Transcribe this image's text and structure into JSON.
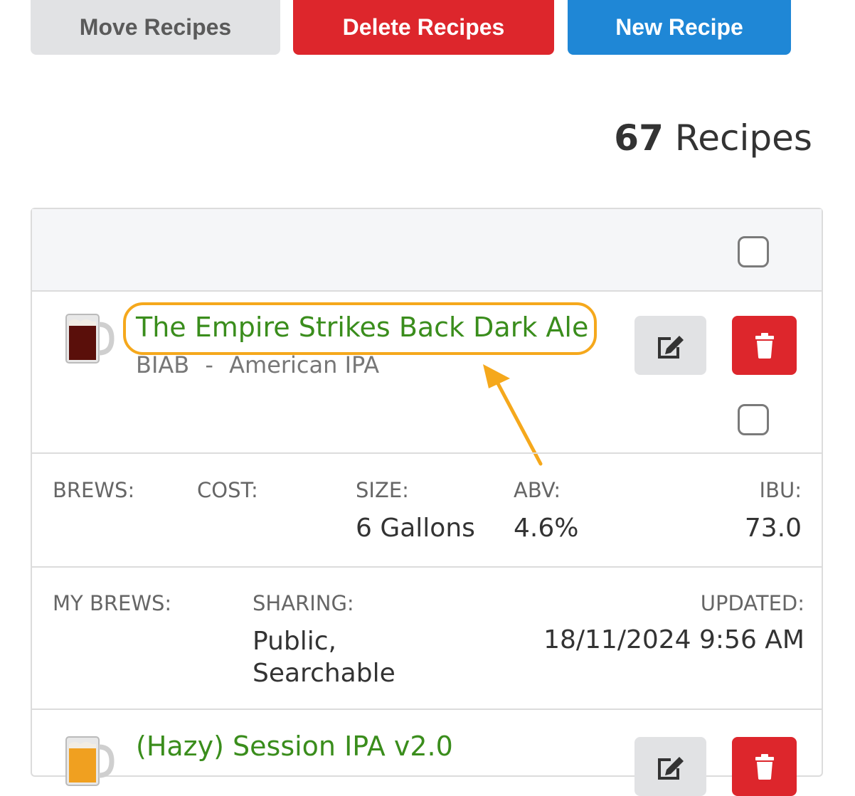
{
  "toolbar": {
    "move_label": "Move Recipes",
    "delete_label": "Delete Recipes",
    "new_label": "New Recipe"
  },
  "summary": {
    "count": "67",
    "count_suffix": "Recipes"
  },
  "recipes": [
    {
      "name": "The Empire Strikes Back Dark Ale",
      "method": "BIAB",
      "separator": "-",
      "style": "American IPA",
      "mug_color": "#5a0f0a",
      "highlighted": true,
      "stats": {
        "brews_label": "BREWS:",
        "cost_label": "COST:",
        "size_label": "SIZE:",
        "size_value": "6 Gallons",
        "abv_label": "ABV:",
        "abv_value": "4.6%",
        "ibu_label": "IBU:",
        "ibu_value": "73.0"
      },
      "meta": {
        "my_brews_label": "MY BREWS:",
        "sharing_label": "SHARING:",
        "sharing_line1": "Public,",
        "sharing_line2": "Searchable",
        "updated_label": "UPDATED:",
        "updated_value": "18/11/2024 9:56 AM"
      }
    },
    {
      "name": "(Hazy) Session IPA v2.0",
      "mug_color": "#f0a020"
    }
  ],
  "colors": {
    "accent_green": "#3a8d1c",
    "danger": "#dd262c",
    "primary": "#1f87d6",
    "highlight": "#f5a81c"
  },
  "icons": {
    "edit": "edit-icon",
    "delete": "trash-icon",
    "mug": "beer-mug-icon"
  }
}
